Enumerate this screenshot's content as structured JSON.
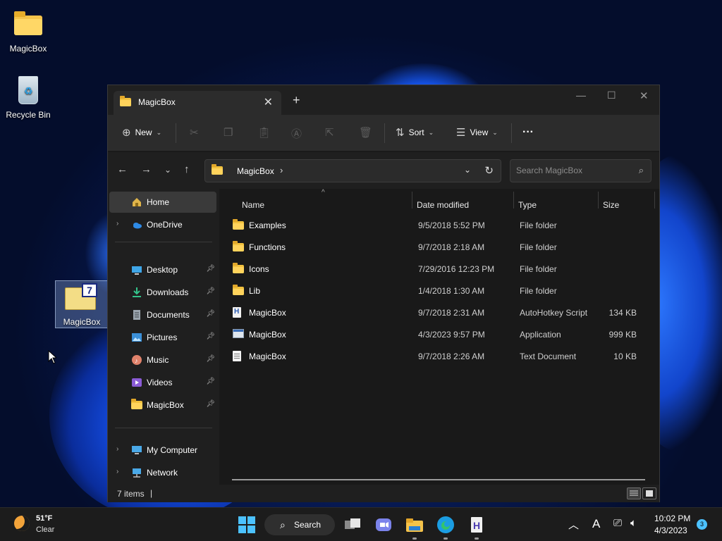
{
  "desktop": {
    "icons": [
      {
        "label": "MagicBox",
        "icon": "folder-icon"
      },
      {
        "label": "Recycle Bin",
        "icon": "recycle-bin-icon"
      }
    ],
    "selected_icon": {
      "label": "MagicBox",
      "icon": "magicbox-app-icon",
      "badge": "7"
    }
  },
  "window": {
    "tab_title": "MagicBox",
    "new_tab_symbol": "+",
    "toolbar": {
      "new_label": "New",
      "sort_label": "Sort",
      "view_label": "View",
      "more_label": "···"
    },
    "address": {
      "crumb": "MagicBox",
      "separator": "›",
      "search_placeholder": "Search MagicBox"
    },
    "nav": {
      "home": "Home",
      "onedrive": "OneDrive",
      "quick_access": [
        {
          "label": "Desktop",
          "icon": "desktop-icon"
        },
        {
          "label": "Downloads",
          "icon": "downloads-icon"
        },
        {
          "label": "Documents",
          "icon": "documents-icon"
        },
        {
          "label": "Pictures",
          "icon": "pictures-icon"
        },
        {
          "label": "Music",
          "icon": "music-icon"
        },
        {
          "label": "Videos",
          "icon": "videos-icon"
        },
        {
          "label": "MagicBox",
          "icon": "folder-icon"
        }
      ],
      "my_computer": "My Computer",
      "network": "Network"
    },
    "columns": {
      "name": "Name",
      "date": "Date modified",
      "type": "Type",
      "size": "Size"
    },
    "files": [
      {
        "name": "Examples",
        "date": "9/5/2018 5:52 PM",
        "type": "File folder",
        "size": "",
        "icon": "folder-icon"
      },
      {
        "name": "Functions",
        "date": "9/7/2018 2:18 AM",
        "type": "File folder",
        "size": "",
        "icon": "folder-icon"
      },
      {
        "name": "Icons",
        "date": "7/29/2016 12:23 PM",
        "type": "File folder",
        "size": "",
        "icon": "folder-icon"
      },
      {
        "name": "Lib",
        "date": "1/4/2018 1:30 AM",
        "type": "File folder",
        "size": "",
        "icon": "folder-icon"
      },
      {
        "name": "MagicBox",
        "date": "9/7/2018 2:31 AM",
        "type": "AutoHotkey Script",
        "size": "134 KB",
        "icon": "ahk-script-icon"
      },
      {
        "name": "MagicBox",
        "date": "4/3/2023 9:57 PM",
        "type": "Application",
        "size": "999 KB",
        "icon": "application-icon"
      },
      {
        "name": "MagicBox",
        "date": "9/7/2018 2:26 AM",
        "type": "Text Document",
        "size": "10 KB",
        "icon": "text-document-icon"
      }
    ],
    "status": {
      "item_count": "7 items",
      "caret": "|"
    }
  },
  "taskbar": {
    "weather_temp": "51°F",
    "weather_cond": "Clear",
    "search_label": "Search",
    "time": "10:02 PM",
    "date": "4/3/2023",
    "notification_count": "3",
    "ime_label": "A"
  },
  "colors": {
    "accent": "#4cc2ff",
    "folder": "#f2c13e",
    "window_bg": "#191919"
  }
}
